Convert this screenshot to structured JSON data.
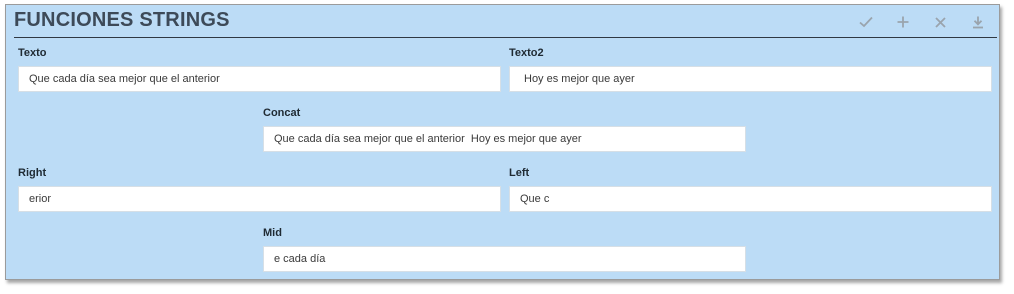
{
  "panel": {
    "title": "FUNCIONES STRINGS",
    "toolbar": {
      "accept_icon": "check-icon",
      "add_icon": "plus-icon",
      "close_icon": "close-icon",
      "download_icon": "download-icon"
    }
  },
  "fields": {
    "texto": {
      "label": "Texto",
      "value": "Que cada día sea mejor que el anterior"
    },
    "texto2": {
      "label": "Texto2",
      "value": "Hoy es mejor que ayer"
    },
    "concat": {
      "label": "Concat",
      "value": "Que cada día sea mejor que el anterior  Hoy es mejor que ayer"
    },
    "right": {
      "label": "Right",
      "value": "erior"
    },
    "left": {
      "label": "Left",
      "value": "Que c"
    },
    "mid": {
      "label": "Mid",
      "value": "e cada día"
    }
  },
  "colors": {
    "panel_background": "#bcdcf6",
    "title": "#3d4a58",
    "toolbar_icons": "#9aa4ad"
  }
}
